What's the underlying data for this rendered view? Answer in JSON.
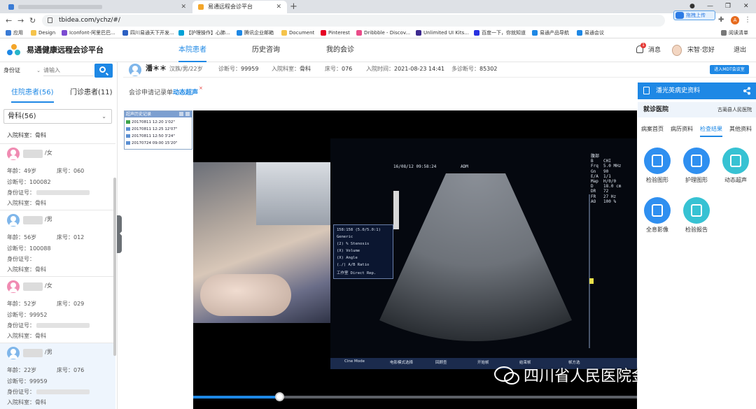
{
  "browser": {
    "tabs": [
      {
        "label": "",
        "active": false
      },
      {
        "label": "易通远程会诊平台",
        "active": true
      }
    ],
    "new_tab": "+",
    "url": "tbidea.com/ychz/#/",
    "upload_badge": "拖拽上传",
    "profile_initial": "A",
    "bookmarks": [
      "应用",
      "Design",
      "Iconfont-阿里巴巴...",
      "四川易通天下开发...",
      "【护理操作】心肺...",
      "腾讯企业邮箱",
      "Document",
      "Pinterest",
      "Dribbble - Discov...",
      "Unlimited UI Kits...",
      "百度一下，你就知道",
      "易通产品导航",
      "易通会议",
      "阅读清单"
    ]
  },
  "header": {
    "title": "易通健康远程会诊平台",
    "nav": [
      "本院患者",
      "历史咨询",
      "我的会诊"
    ],
    "notification_count": "1",
    "message_label": "消息",
    "user_greeting": "宋智·您好",
    "logout_label": "退出"
  },
  "sidebar": {
    "id_type": "身份证",
    "search_placeholder": "请输入",
    "tabs": [
      "住院患者(56)",
      "门诊患者(11)"
    ],
    "department_filter": "骨科(56)",
    "top_department": "入院科室：骨科",
    "patients": [
      {
        "gender": "/女",
        "age": "年龄：49岁",
        "bed": "床号：060",
        "diag_no": "诊断号：100082",
        "id_label": "身份证号：",
        "dept": "入院科室：骨科",
        "avatar": "female"
      },
      {
        "gender": "/男",
        "age": "年龄：56岁",
        "bed": "床号：012",
        "diag_no": "诊断号：100088",
        "id_label": "身份证号：",
        "dept": "入院科室：骨科",
        "avatar": "male"
      },
      {
        "gender": "/女",
        "age": "年龄：52岁",
        "bed": "床号：029",
        "diag_no": "诊断号：99952",
        "id_label": "身份证号：",
        "dept": "入院科室：骨科",
        "avatar": "female"
      },
      {
        "gender": "/男",
        "age": "年龄：22岁",
        "bed": "床号：076",
        "diag_no": "诊断号：99959",
        "id_label": "身份证号：",
        "dept": "入院科室：骨科",
        "avatar": "male"
      }
    ]
  },
  "patient_info": {
    "name": "潘＊＊",
    "demographics": "汉族/男/22岁",
    "diag_no_label": "诊断号：",
    "diag_no": "99959",
    "dept_label": "入院科室：",
    "dept": "骨科",
    "bed_label": "床号：",
    "bed": "076",
    "admit_label": "入院时间：",
    "admit_time": "2021-08-23 14:41",
    "multi_diag_label": "多诊断号：",
    "multi_diag_no": "85302",
    "mdt_button": "进入MDT会议室"
  },
  "subtabs": {
    "record": "会诊申请记录单",
    "active": "动态超声",
    "close": "×"
  },
  "history": {
    "title": "超声历史记录",
    "rows": [
      {
        "date": "20170811",
        "time": "12:20",
        "duration": "1'02\"",
        "color": "green"
      },
      {
        "date": "20170811",
        "time": "12:25",
        "duration": "12'07\"",
        "color": "blue"
      },
      {
        "date": "20170811",
        "time": "12:50",
        "duration": "3'24\"",
        "color": "blue"
      },
      {
        "date": "20170724",
        "time": "09:00",
        "duration": "15'20\"",
        "color": "blue"
      }
    ]
  },
  "ultrasound": {
    "date": "16/08/12 09:58:24",
    "mode": "ADM",
    "params": "腹部\nB    CHI\nFrq  5.0 MHz\nGn   90\nE/A  1/1\nMap  H/0/0\nD    18.0 cm\nDR   72\nFR   27 Hz\nAO   100 %",
    "menu": [
      "158:158  (5.0/5.0:1)",
      "Generic",
      "(2) % Stenosis",
      "(X) Volume",
      "(X) Angle",
      "(./) A/B Ratio",
      "工作室    Direct Rep."
    ],
    "bottom_cells": [
      "Cine Mode",
      "电影模式选择",
      "回顾查",
      "开始帧",
      "结束帧",
      "帧方选"
    ],
    "progress_pct": 19.5
  },
  "watermark": "四川省人民医院金牛医院",
  "right_panel": {
    "title": "潘光英病史资料",
    "hospital_label": "就诊医院",
    "hospital_value": "古蔺县人民医院",
    "tabs": [
      "病案首页",
      "病历资料",
      "检查结果",
      "其他资料"
    ],
    "active_tab": "检查结果",
    "icons": [
      {
        "label": "检验图形",
        "color": "blue"
      },
      {
        "label": "护理图形",
        "color": "blue"
      },
      {
        "label": "动态超声",
        "color": "cyan"
      },
      {
        "label": "全息影像",
        "color": "blue"
      },
      {
        "label": "检验报告",
        "color": "cyan"
      }
    ]
  }
}
